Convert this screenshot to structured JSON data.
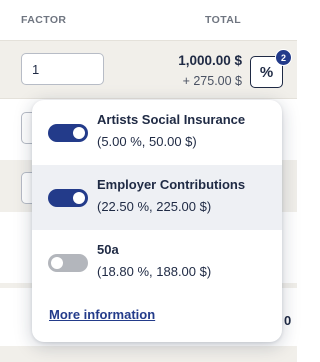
{
  "header": {
    "factor_label": "FACTOR",
    "total_label": "TOTAL"
  },
  "row": {
    "factor_value": "1",
    "total_main": "1,000.00 $",
    "total_extra": "+ 275.00 $",
    "percent_button_label": "%",
    "badge_count": "2"
  },
  "popover": {
    "options": [
      {
        "title": "Artists Social Insurance",
        "detail": "(5.00 %, 50.00 $)",
        "enabled": true
      },
      {
        "title": "Employer Contributions",
        "detail": "(22.50 %, 225.00 $)",
        "enabled": true
      },
      {
        "title": "50a",
        "detail": "(18.80 %, 188.00 $)",
        "enabled": false
      }
    ],
    "more_link": "More information"
  },
  "colors": {
    "accent": "#233b8a",
    "toggle_off": "#b3b6bc",
    "row_background": "#f1efea",
    "highlight": "#eef0f4"
  }
}
